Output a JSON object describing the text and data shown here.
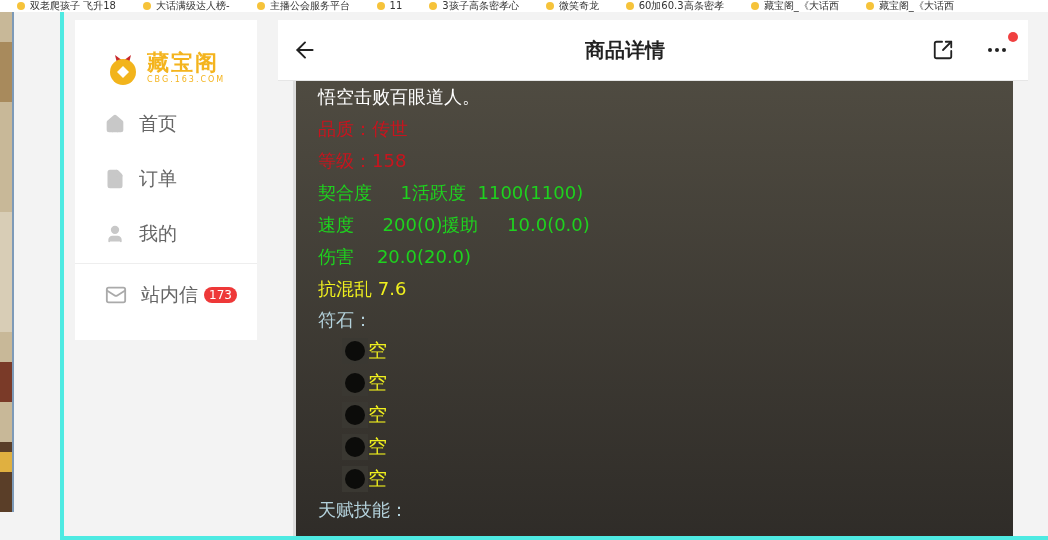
{
  "bookmarks": [
    {
      "label": "双老爬孩子 飞升18"
    },
    {
      "label": "大话满级达人榜-"
    },
    {
      "label": "主播公会服务平台"
    },
    {
      "label": "11"
    },
    {
      "label": "3孩子高条密孝心"
    },
    {
      "label": "微笑奇龙"
    },
    {
      "label": "60加60.3高条密孝"
    },
    {
      "label": "藏宝阁_《大话西"
    },
    {
      "label": "藏宝阁_《大话西"
    }
  ],
  "sidebar": {
    "logo": {
      "name": "藏宝阁",
      "domain": "CBG.163.COM"
    },
    "items": [
      {
        "label": "首页",
        "kind": "home"
      },
      {
        "label": "订单",
        "kind": "order"
      },
      {
        "label": "我的",
        "kind": "user"
      }
    ],
    "messages": {
      "label": "站内信",
      "badge": "173"
    }
  },
  "header": {
    "title": "商品详情",
    "notification": true
  },
  "details": {
    "lines": [
      {
        "text": "悟空击败百眼道人。",
        "color": "#ffffff"
      },
      {
        "text": "品质：传世",
        "color": "#c8141e"
      },
      {
        "text": "等级：158",
        "color": "#c8141e"
      },
      {
        "text": "契合度     1活跃度  1100(1100)",
        "color": "#1ed21e"
      },
      {
        "text": "速度     200(0)援助     10.0(0.0)",
        "color": "#1ed21e"
      },
      {
        "text": "伤害    20.0(20.0)",
        "color": "#1ed21e"
      },
      {
        "text": "抗混乱 7.6",
        "color": "#f0f01e"
      }
    ],
    "runes": {
      "label": "符石：",
      "slots": [
        {
          "text": "空"
        },
        {
          "text": "空"
        },
        {
          "text": "空"
        },
        {
          "text": "空"
        },
        {
          "text": "空"
        }
      ]
    },
    "talent": {
      "label": "天赋技能："
    }
  }
}
